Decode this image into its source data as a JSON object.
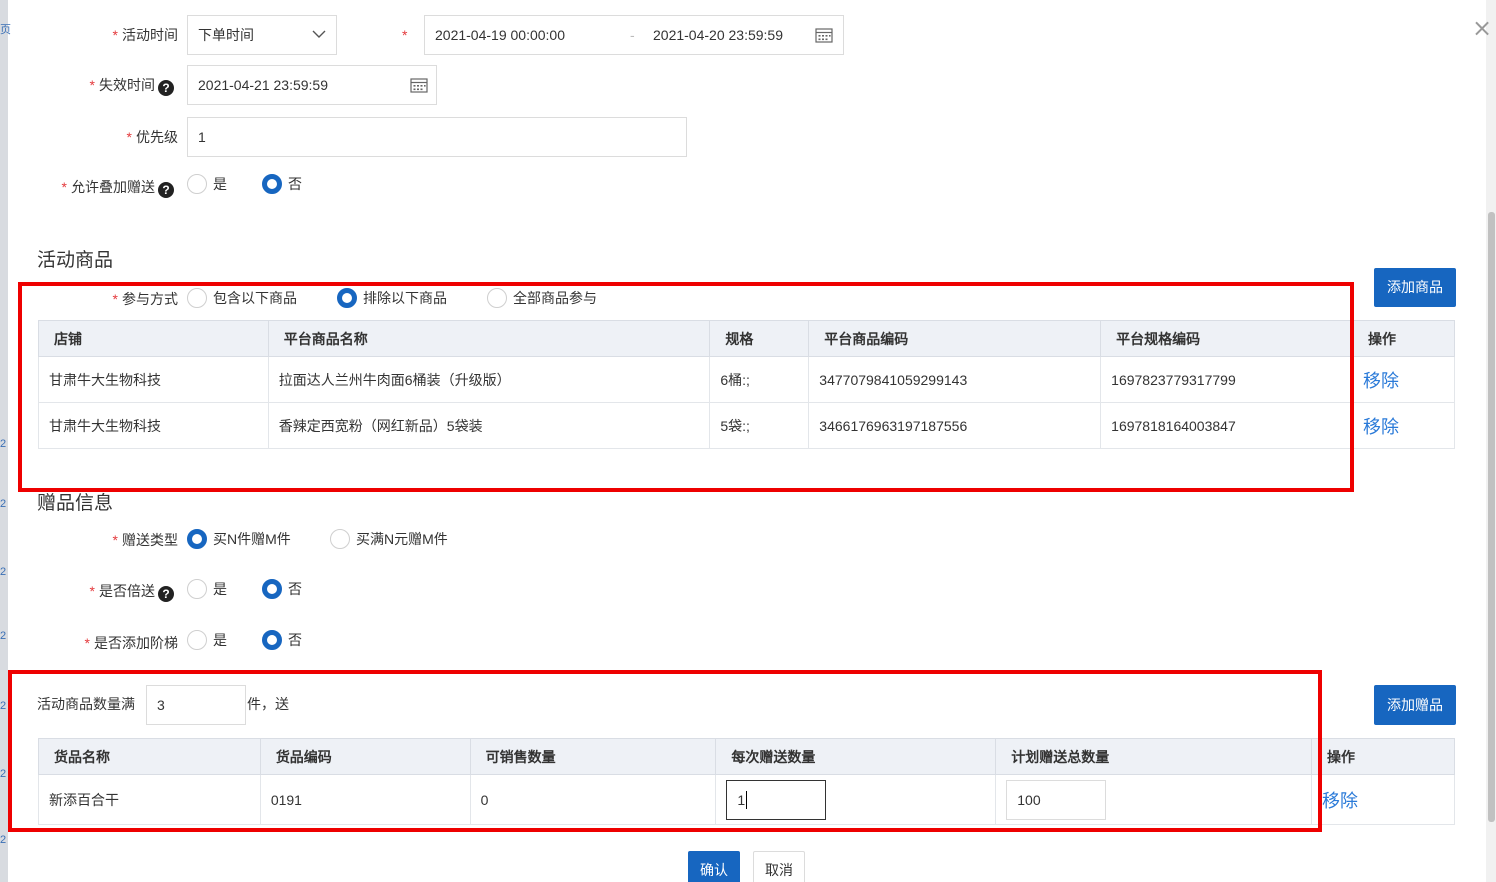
{
  "form": {
    "activity_time_label": "活动时间",
    "activity_time_type": "下单时间",
    "date_range_start": "2021-04-19 00:00:00",
    "date_range_sep": "-",
    "date_range_end": "2021-04-20 23:59:59",
    "expire_label": "失效时间",
    "expire_value": "2021-04-21 23:59:59",
    "priority_label": "优先级",
    "priority_value": "1",
    "allow_stack_label": "允许叠加赠送",
    "yes": "是",
    "no": "否",
    "required_mark": "*",
    "help_mark": "?"
  },
  "goods_section": {
    "title": "活动商品",
    "add_button": "添加商品",
    "participation_label": "参与方式",
    "options": [
      "包含以下商品",
      "排除以下商品",
      "全部商品参与"
    ],
    "selected_index": 1,
    "columns": [
      "店铺",
      "平台商品名称",
      "规格",
      "平台商品编码",
      "平台规格编码",
      "操作"
    ],
    "rows": [
      [
        "甘肃牛大生物科技",
        "拉面达人兰州牛肉面6桶装（升级版）",
        "6桶:;",
        "3477079841059299143",
        "1697823779317799",
        "移除"
      ],
      [
        "甘肃牛大生物科技",
        "香辣定西宽粉（网红新品）5袋装",
        "5袋:;",
        "3466176963197187556",
        "1697818164003847",
        "移除"
      ]
    ]
  },
  "gift_section": {
    "title": "赠品信息",
    "gift_type_label": "赠送类型",
    "gift_type_options": [
      "买N件赠M件",
      "买满N元赠M件"
    ],
    "double_label": "是否倍送",
    "tier_label": "是否添加阶梯",
    "threshold_prefix": "活动商品数量满",
    "threshold_value": "3",
    "threshold_suffix": "件，送",
    "add_button": "添加赠品",
    "columns": [
      "货品名称",
      "货品编码",
      "可销售数量",
      "每次赠送数量",
      "计划赠送总数量",
      "操作"
    ],
    "row": {
      "name": "新添百合干",
      "code": "0191",
      "stock": "0",
      "per_qty": "1",
      "total_qty": "100",
      "action": "移除"
    }
  },
  "footer": {
    "confirm": "确认",
    "cancel": "取消"
  },
  "background_marks": [
    "页",
    "2",
    "2",
    "2",
    "2",
    "2",
    "2",
    "2"
  ],
  "colors": {
    "primary": "#1766c0",
    "highlight": "#ee0000",
    "link": "#2a7ad8",
    "required": "#e4393c"
  }
}
